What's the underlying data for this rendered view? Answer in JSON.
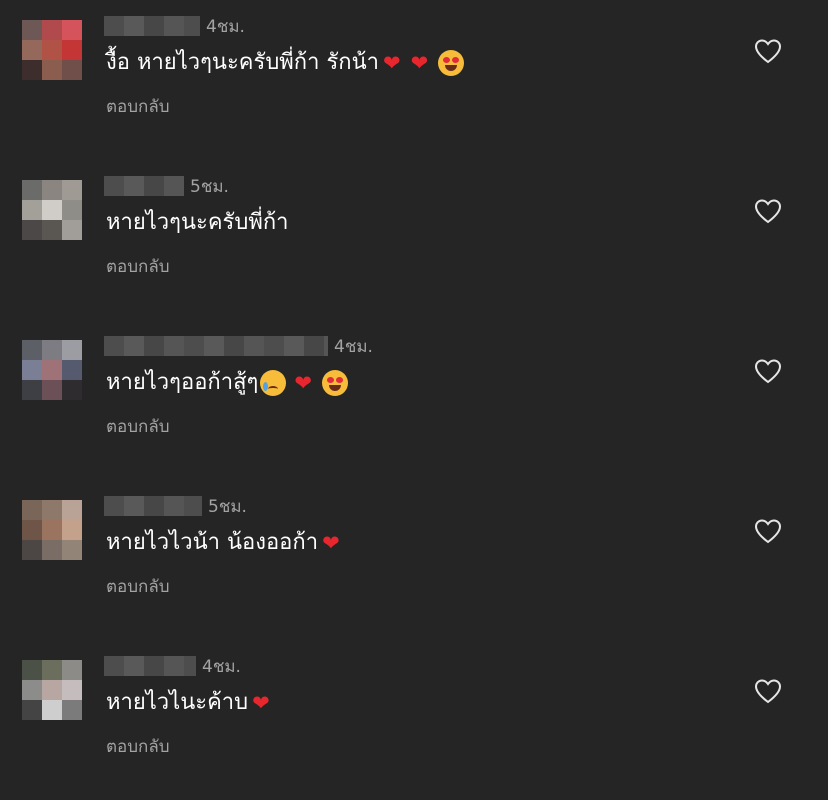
{
  "comments": [
    {
      "time": "4ชม.",
      "text": "งื้อ หายไวๆนะครับพี่ก้า รักน้า",
      "emojis": [
        "heart",
        "heart",
        "heart-eyes"
      ],
      "reply_label": "ตอบกลับ",
      "avatar_colors": [
        "#6d5855",
        "#b04a4d",
        "#d5535b",
        "#94685b",
        "#b05245",
        "#c43636",
        "#3e2d2d",
        "#8b5d4e",
        "#704e4a"
      ]
    },
    {
      "time": "5ชม.",
      "text": "หายไวๆนะครับพี่ก้า",
      "emojis": [],
      "reply_label": "ตอบกลับ",
      "avatar_colors": [
        "#6b6b69",
        "#8a8580",
        "#9f9a94",
        "#a3a09a",
        "#d0ccc8",
        "#8e8d88",
        "#4b4847",
        "#5a5652",
        "#a19e9a"
      ]
    },
    {
      "time": "4ชม.",
      "text": "หายไวๆออก้าสู้ๆ",
      "emojis": [
        "cry",
        "heart",
        "heart-eyes"
      ],
      "reply_label": "ตอบกลับ",
      "avatar_colors": [
        "#5c5f66",
        "#7d7c83",
        "#9c9ca3",
        "#7a7f95",
        "#9e7276",
        "#555a6f",
        "#3e3f45",
        "#6b5058",
        "#2f2c30"
      ]
    },
    {
      "time": "5ชม.",
      "text": "หายไวไวน้า น้องออก้า",
      "emojis": [
        "heart"
      ],
      "reply_label": "ตอบกลับ",
      "avatar_colors": [
        "#7a6559",
        "#8e7869",
        "#b8a396",
        "#6e5548",
        "#9b7460",
        "#c4a18b",
        "#4c4744",
        "#7a6d66",
        "#938478"
      ]
    },
    {
      "time": "4ชม.",
      "text": "หายไวไนะค้าบ",
      "emojis": [
        "heart"
      ],
      "reply_label": "ตอบกลับ",
      "avatar_colors": [
        "#4b5147",
        "#6b6e5c",
        "#8d8b88",
        "#8c8d8a",
        "#b7a6a2",
        "#c4bcbd",
        "#444444",
        "#cfcecf",
        "#7b7b7b"
      ]
    }
  ],
  "colors": {
    "background": "#252525",
    "text": "#ffffff",
    "muted": "#a3a3a3",
    "heart_emoji": "#e8262e"
  },
  "icons": {
    "like": "heart-outline-icon"
  }
}
